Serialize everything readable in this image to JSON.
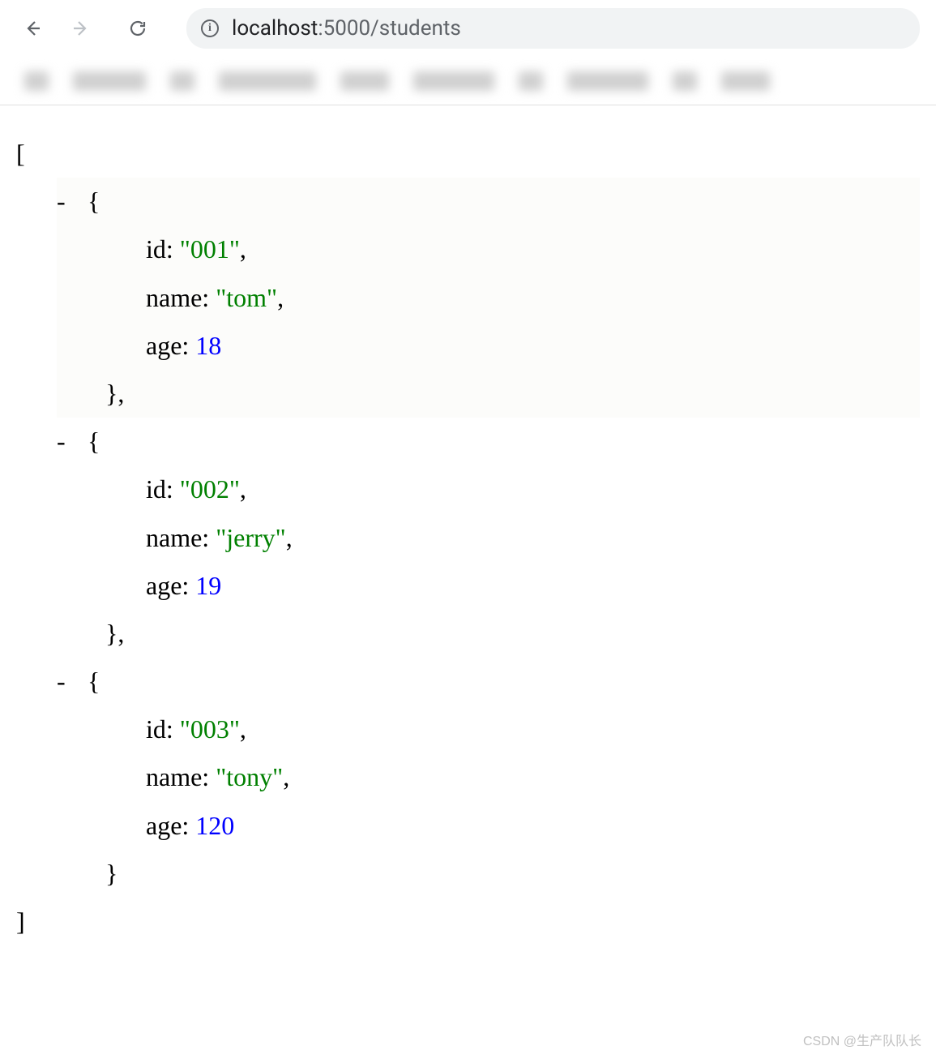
{
  "toolbar": {
    "url_host": "localhost",
    "url_path": ":5000/students"
  },
  "json": {
    "open_bracket": "[",
    "close_bracket": "]",
    "dash": "-",
    "open_brace": "{",
    "close_brace": "}",
    "comma": ",",
    "items": [
      {
        "fields": [
          {
            "key": "id",
            "value": "\"001\"",
            "type": "str",
            "trailing": ","
          },
          {
            "key": "name",
            "value": "\"tom\"",
            "type": "str",
            "trailing": ","
          },
          {
            "key": "age",
            "value": "18",
            "type": "num",
            "trailing": ""
          }
        ],
        "end_comma": ","
      },
      {
        "fields": [
          {
            "key": "id",
            "value": "\"002\"",
            "type": "str",
            "trailing": ","
          },
          {
            "key": "name",
            "value": "\"jerry\"",
            "type": "str",
            "trailing": ","
          },
          {
            "key": "age",
            "value": "19",
            "type": "num",
            "trailing": ""
          }
        ],
        "end_comma": ","
      },
      {
        "fields": [
          {
            "key": "id",
            "value": "\"003\"",
            "type": "str",
            "trailing": ","
          },
          {
            "key": "name",
            "value": "\"tony\"",
            "type": "str",
            "trailing": ","
          },
          {
            "key": "age",
            "value": "120",
            "type": "num",
            "trailing": ""
          }
        ],
        "end_comma": ""
      }
    ]
  },
  "watermark": "CSDN @生产队队长"
}
